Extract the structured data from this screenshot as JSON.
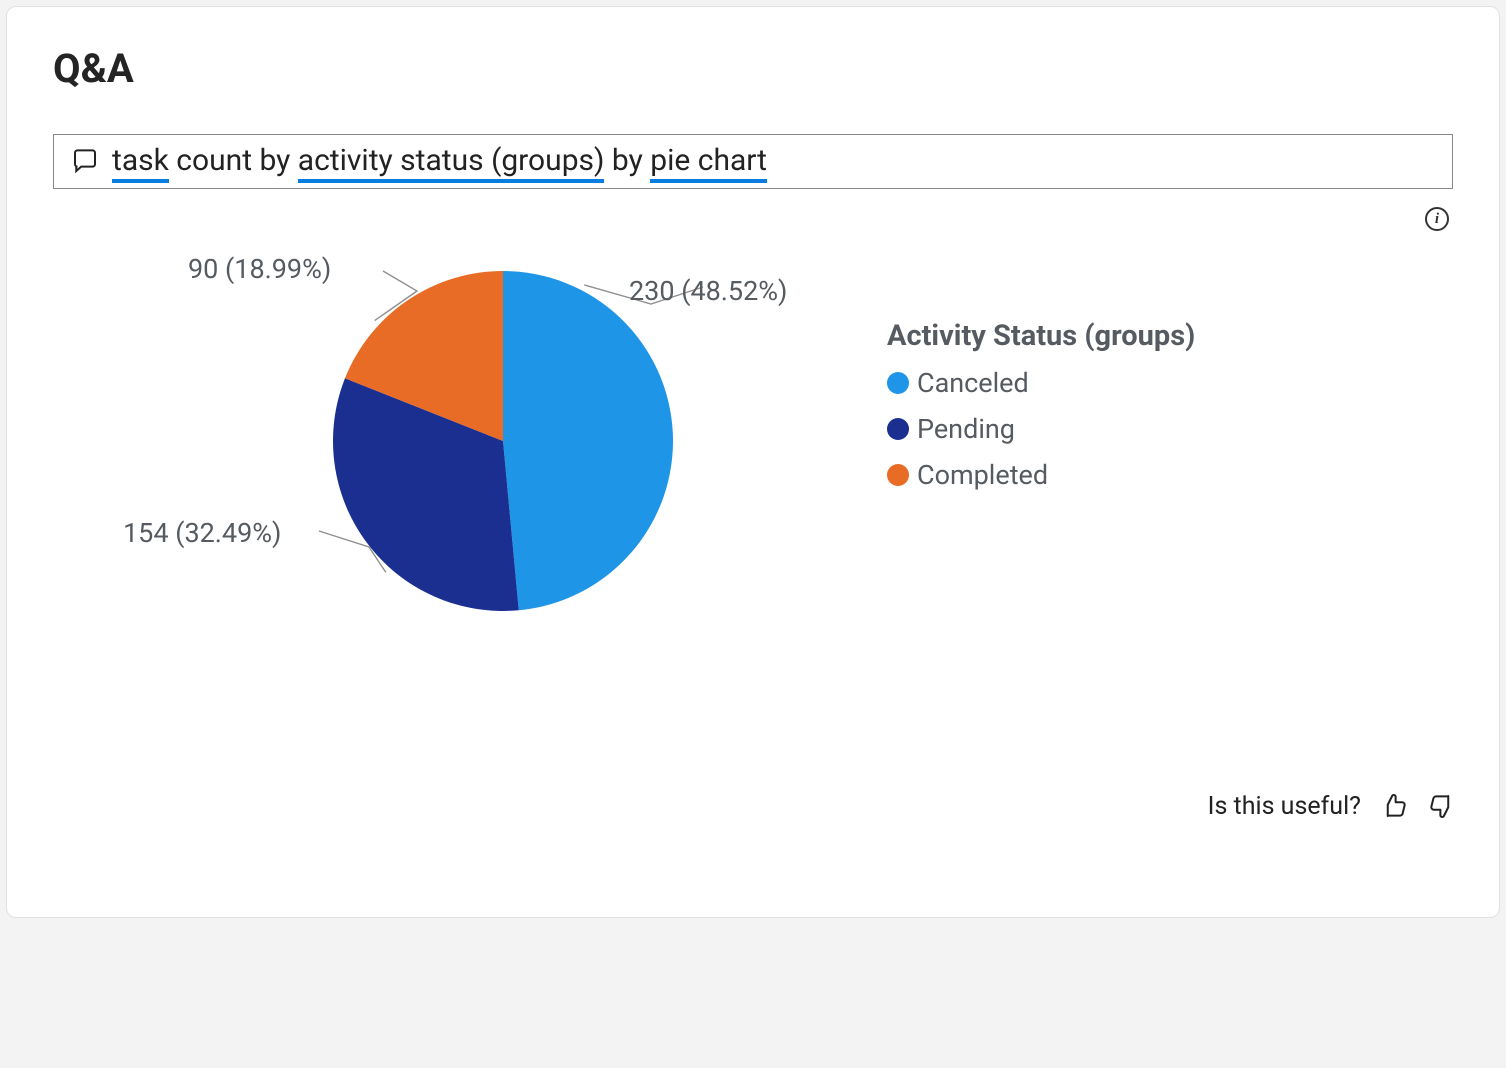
{
  "title": "Q&A",
  "qa": {
    "prefix_task": "task",
    "count_by": " count by ",
    "group": "activity status (groups)",
    "by": " by ",
    "chart_type": "pie chart"
  },
  "legend_title": "Activity Status (groups)",
  "feedback_prompt": "Is this useful?",
  "chart_data": {
    "type": "pie",
    "title": "",
    "categories": [
      "Canceled",
      "Pending",
      "Completed"
    ],
    "series": [
      {
        "name": "Canceled",
        "value": 230,
        "percent": 48.52,
        "color": "#1f95e8",
        "label": "230 (48.52%)"
      },
      {
        "name": "Pending",
        "value": 154,
        "percent": 32.49,
        "color": "#1b2f91",
        "label": "154 (32.49%)"
      },
      {
        "name": "Completed",
        "value": 90,
        "percent": 18.99,
        "color": "#e86c25",
        "label": "90 (18.99%)"
      }
    ]
  }
}
